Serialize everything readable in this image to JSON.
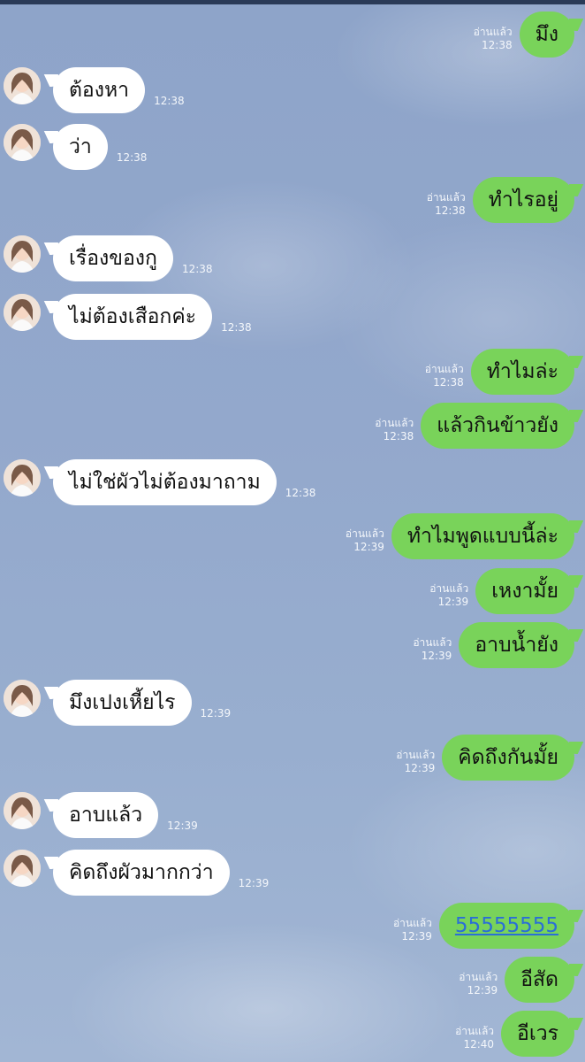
{
  "chat": {
    "read_label": "อ่านแล้ว",
    "messages": [
      {
        "dir": "out",
        "text": "มึง",
        "time": "12:38",
        "read": "อ่านแล้ว"
      },
      {
        "dir": "in",
        "text": "ต้องหา",
        "time": "12:38"
      },
      {
        "dir": "in",
        "text": "ว่า",
        "time": "12:38"
      },
      {
        "dir": "out",
        "text": "ทำไรอยู่",
        "time": "12:38",
        "read": "อ่านแล้ว"
      },
      {
        "dir": "in",
        "text": "เรื่องของกู",
        "time": "12:38"
      },
      {
        "dir": "in",
        "text": "ไม่ต้องเสือกค่ะ",
        "time": "12:38"
      },
      {
        "dir": "out",
        "text": "ทำไมล่ะ",
        "time": "12:38",
        "read": "อ่านแล้ว"
      },
      {
        "dir": "out",
        "text": "แล้วกินข้าวยัง",
        "time": "12:38",
        "read": "อ่านแล้ว"
      },
      {
        "dir": "in",
        "text": "ไม่ใช่ผัวไม่ต้องมาถาม",
        "time": "12:38"
      },
      {
        "dir": "out",
        "text": "ทำไมพูดแบบนี้ล่ะ",
        "time": "12:39",
        "read": "อ่านแล้ว"
      },
      {
        "dir": "out",
        "text": "เหงามั้ย",
        "time": "12:39",
        "read": "อ่านแล้ว"
      },
      {
        "dir": "out",
        "text": "อาบน้ำยัง",
        "time": "12:39",
        "read": "อ่านแล้ว"
      },
      {
        "dir": "in",
        "text": "มึงเปงเหี้ยไร",
        "time": "12:39"
      },
      {
        "dir": "out",
        "text": "คิดถึงกันมั้ย",
        "time": "12:39",
        "read": "อ่านแล้ว"
      },
      {
        "dir": "in",
        "text": "อาบแล้ว",
        "time": "12:39"
      },
      {
        "dir": "in",
        "text": "คิดถึงผัวมากกว่า",
        "time": "12:39"
      },
      {
        "dir": "out",
        "text": "55555555",
        "time": "12:39",
        "read": "อ่านแล้ว",
        "link": true
      },
      {
        "dir": "out",
        "text": "อีสัด",
        "time": "12:39",
        "read": "อ่านแล้ว"
      },
      {
        "dir": "out",
        "text": "อีเวร",
        "time": "12:40",
        "read": "อ่านแล้ว"
      }
    ]
  },
  "colors": {
    "outgoing_bubble": "#79d35a",
    "incoming_bubble": "#ffffff",
    "background": "#93a8cc",
    "link": "#2a6fd6"
  },
  "icons": {
    "avatar": "contact-avatar-icon"
  }
}
